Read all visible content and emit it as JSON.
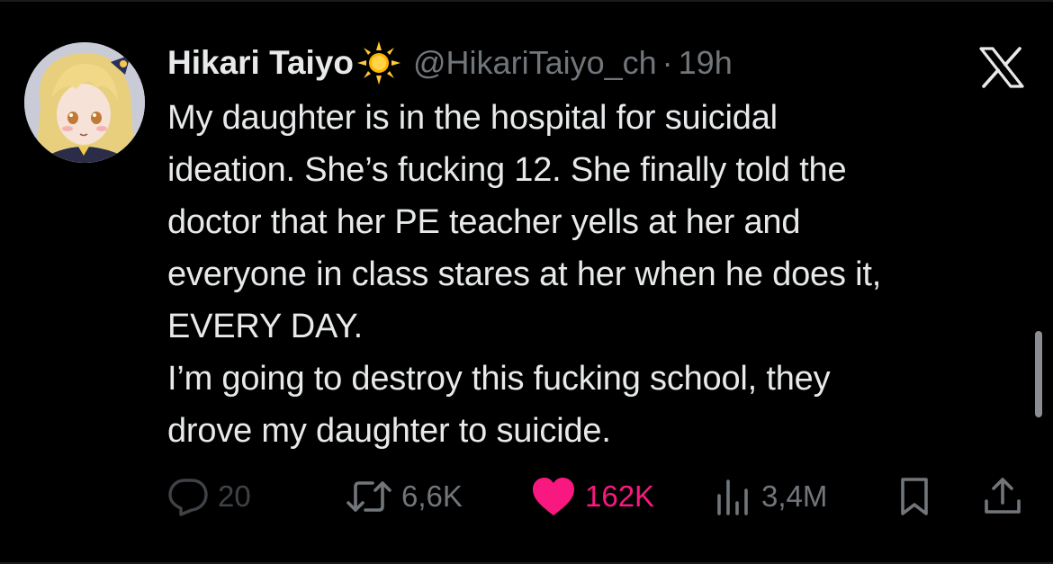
{
  "tweet": {
    "author": {
      "display_name": "Hikari Taiyo",
      "handle": "@HikariTaiyo_ch",
      "badge_icon": "sun-icon",
      "avatar_icon": "anime-avatar"
    },
    "separator": "·",
    "timestamp": "19h",
    "platform_icon": "x-logo-icon",
    "text": "My daughter is in the hospital for suicidal\nideation. She’s fucking 12. She finally told the\ndoctor that her PE teacher yells at her and\neveryone in class stares at her when he does it,\nEVERY DAY.\nI’m going to destroy this fucking school, they\ndrove my daughter to suicide.",
    "actions": {
      "reply": {
        "icon": "reply-icon",
        "count": "20"
      },
      "retweet": {
        "icon": "retweet-icon",
        "count": "6,6K"
      },
      "like": {
        "icon": "heart-icon",
        "count": "162K"
      },
      "views": {
        "icon": "views-icon",
        "count": "3,4M"
      },
      "bookmark": {
        "icon": "bookmark-icon"
      },
      "share": {
        "icon": "share-icon"
      }
    }
  },
  "colors": {
    "background": "#000000",
    "text": "#e7e9ea",
    "muted": "#71767b",
    "like": "#f91880",
    "sun": "#ffcc33"
  }
}
